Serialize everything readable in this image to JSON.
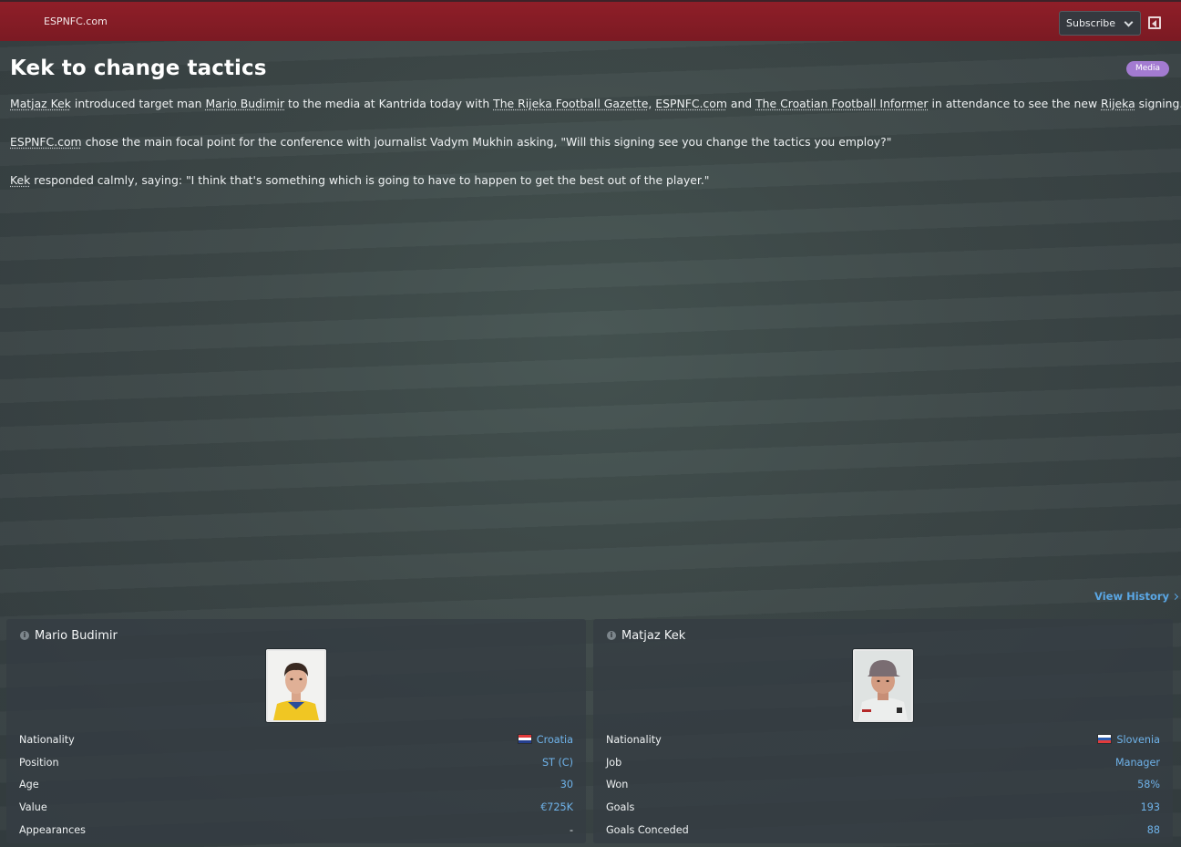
{
  "header": {
    "source": "ESPNFC.com",
    "subscribe_label": "Subscribe"
  },
  "article": {
    "title": "Kek to change tactics",
    "badge": "Media",
    "p1": {
      "manager": "Matjaz Kek",
      "t1": " introduced target man ",
      "player": "Mario Budimir",
      "t2": " to the media at Kantrida today with ",
      "outlet1": "The Rijeka Football Gazette",
      "sep1": ", ",
      "outlet2": "ESPNFC.com",
      "t3": " and ",
      "outlet3": "The Croatian Football Informer",
      "t4": " in attendance to see the new ",
      "club": "Rijeka",
      "t5": " signing."
    },
    "p2": {
      "outlet": "ESPNFC.com",
      "text": " chose the main focal point for the conference with journalist Vadym Mukhin asking, \"Will this signing see you change the tactics you employ?\""
    },
    "p3": {
      "manager": "Kek",
      "text": " responded calmly, saying: \"I think that's something which is going to have to happen to get the best out of the player.\""
    },
    "view_history": "View History"
  },
  "cards": {
    "player": {
      "name": "Mario Budimir",
      "rows": [
        {
          "label": "Nationality",
          "value": "Croatia"
        },
        {
          "label": "Position",
          "value": "ST (C)"
        },
        {
          "label": "Age",
          "value": "30"
        },
        {
          "label": "Value",
          "value": "€725K"
        },
        {
          "label": "Appearances",
          "value": "-"
        }
      ]
    },
    "manager": {
      "name": "Matjaz Kek",
      "rows": [
        {
          "label": "Nationality",
          "value": "Slovenia"
        },
        {
          "label": "Job",
          "value": "Manager"
        },
        {
          "label": "Won",
          "value": "58%"
        },
        {
          "label": "Goals",
          "value": "193"
        },
        {
          "label": "Goals Conceded",
          "value": "88"
        }
      ]
    }
  },
  "colors": {
    "header_red": "#8f1e28",
    "link_blue": "#5aa7e5",
    "badge_purple": "#a37bd1"
  }
}
